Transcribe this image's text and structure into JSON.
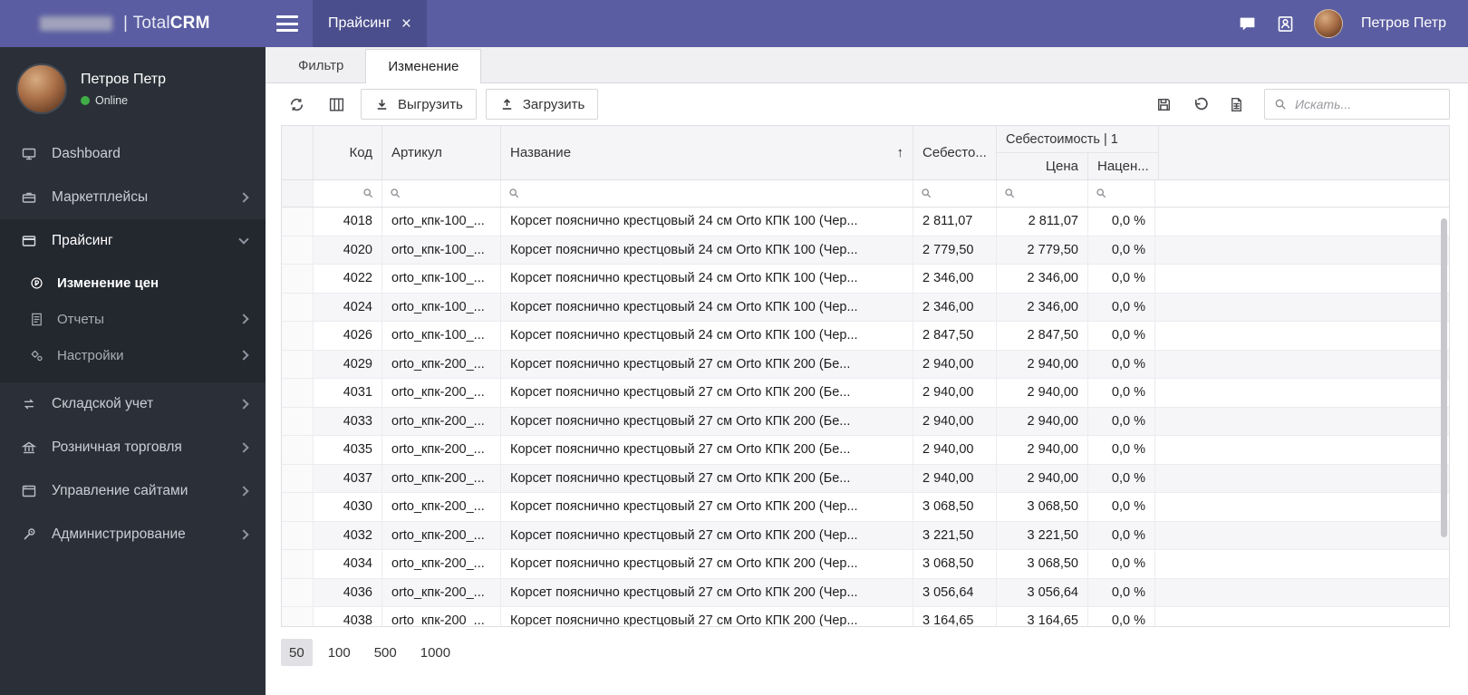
{
  "colors": {
    "header_purple": "#5a5da1",
    "header_tab_dark": "#4b4e8c",
    "sidebar_dark": "#2b3038",
    "online_green": "#3fae46",
    "pager_selected": "#e1e1e5"
  },
  "brand": {
    "pipe": "|",
    "total": "Total",
    "crm": "CRM"
  },
  "header": {
    "tab_label": "Прайсинг",
    "tab_close": "×",
    "user_name": "Петров Петр"
  },
  "sidebar": {
    "user": {
      "name": "Петров Петр",
      "status": "Online"
    },
    "items": [
      {
        "label": "Dashboard"
      },
      {
        "label": "Маркетплейсы"
      },
      {
        "label": "Прайсинг"
      },
      {
        "label": "Изменение цен"
      },
      {
        "label": "Отчеты"
      },
      {
        "label": "Настройки"
      },
      {
        "label": "Складской учет"
      },
      {
        "label": "Розничная торговля"
      },
      {
        "label": "Управление сайтами"
      },
      {
        "label": "Администрирование"
      }
    ]
  },
  "main": {
    "tabs": [
      {
        "label": "Фильтр"
      },
      {
        "label": "Изменение"
      }
    ],
    "toolbar": {
      "export_label": "Выгрузить",
      "import_label": "Загрузить",
      "search_placeholder": "Искать..."
    },
    "table": {
      "headers": {
        "code": "Код",
        "article": "Артикул",
        "name": "Название",
        "sort_indicator": "↑",
        "cost": "Себесто...",
        "cost_group": "Себестоимость | 1",
        "price": "Цена",
        "markup": "Нацен..."
      },
      "rows": [
        {
          "code": "4018",
          "article": "orto_кпк-100_...",
          "name": "Корсет пояснично крестцовый 24 см Orto КПК 100 (Чер...",
          "cost": "2 811,07",
          "price": "2 811,07",
          "markup": "0,0 %"
        },
        {
          "code": "4020",
          "article": "orto_кпк-100_...",
          "name": "Корсет пояснично крестцовый 24 см Orto КПК 100 (Чер...",
          "cost": "2 779,50",
          "price": "2 779,50",
          "markup": "0,0 %"
        },
        {
          "code": "4022",
          "article": "orto_кпк-100_...",
          "name": "Корсет пояснично крестцовый 24 см Orto КПК 100 (Чер...",
          "cost": "2 346,00",
          "price": "2 346,00",
          "markup": "0,0 %"
        },
        {
          "code": "4024",
          "article": "orto_кпк-100_...",
          "name": "Корсет пояснично крестцовый 24 см Orto КПК 100 (Чер...",
          "cost": "2 346,00",
          "price": "2 346,00",
          "markup": "0,0 %"
        },
        {
          "code": "4026",
          "article": "orto_кпк-100_...",
          "name": "Корсет пояснично крестцовый 24 см Orto КПК 100 (Чер...",
          "cost": "2 847,50",
          "price": "2 847,50",
          "markup": "0,0 %"
        },
        {
          "code": "4029",
          "article": "orto_кпк-200_...",
          "name": "Корсет пояснично крестцовый 27 см Orto КПК 200 (Бе...",
          "cost": "2 940,00",
          "price": "2 940,00",
          "markup": "0,0 %"
        },
        {
          "code": "4031",
          "article": "orto_кпк-200_...",
          "name": "Корсет пояснично крестцовый 27 см Orto КПК 200 (Бе...",
          "cost": "2 940,00",
          "price": "2 940,00",
          "markup": "0,0 %"
        },
        {
          "code": "4033",
          "article": "orto_кпк-200_...",
          "name": "Корсет пояснично крестцовый 27 см Orto КПК 200 (Бе...",
          "cost": "2 940,00",
          "price": "2 940,00",
          "markup": "0,0 %"
        },
        {
          "code": "4035",
          "article": "orto_кпк-200_...",
          "name": "Корсет пояснично крестцовый 27 см Orto КПК 200 (Бе...",
          "cost": "2 940,00",
          "price": "2 940,00",
          "markup": "0,0 %"
        },
        {
          "code": "4037",
          "article": "orto_кпк-200_...",
          "name": "Корсет пояснично крестцовый 27 см Orto КПК 200 (Бе...",
          "cost": "2 940,00",
          "price": "2 940,00",
          "markup": "0,0 %"
        },
        {
          "code": "4030",
          "article": "orto_кпк-200_...",
          "name": "Корсет пояснично крестцовый 27 см Orto КПК 200 (Чер...",
          "cost": "3 068,50",
          "price": "3 068,50",
          "markup": "0,0 %"
        },
        {
          "code": "4032",
          "article": "orto_кпк-200_...",
          "name": "Корсет пояснично крестцовый 27 см Orto КПК 200 (Чер...",
          "cost": "3 221,50",
          "price": "3 221,50",
          "markup": "0,0 %"
        },
        {
          "code": "4034",
          "article": "orto_кпк-200_...",
          "name": "Корсет пояснично крестцовый 27 см Orto КПК 200 (Чер...",
          "cost": "3 068,50",
          "price": "3 068,50",
          "markup": "0,0 %"
        },
        {
          "code": "4036",
          "article": "orto_кпк-200_...",
          "name": "Корсет пояснично крестцовый 27 см Orto КПК 200 (Чер...",
          "cost": "3 056,64",
          "price": "3 056,64",
          "markup": "0,0 %"
        },
        {
          "code": "4038",
          "article": "orto_кпк-200_...",
          "name": "Корсет пояснично крестцовый 27 см Orto КПК 200 (Чер...",
          "cost": "3 164,65",
          "price": "3 164,65",
          "markup": "0,0 %"
        }
      ]
    },
    "pagination": {
      "options": [
        "50",
        "100",
        "500",
        "1000"
      ],
      "selected": "50"
    }
  }
}
